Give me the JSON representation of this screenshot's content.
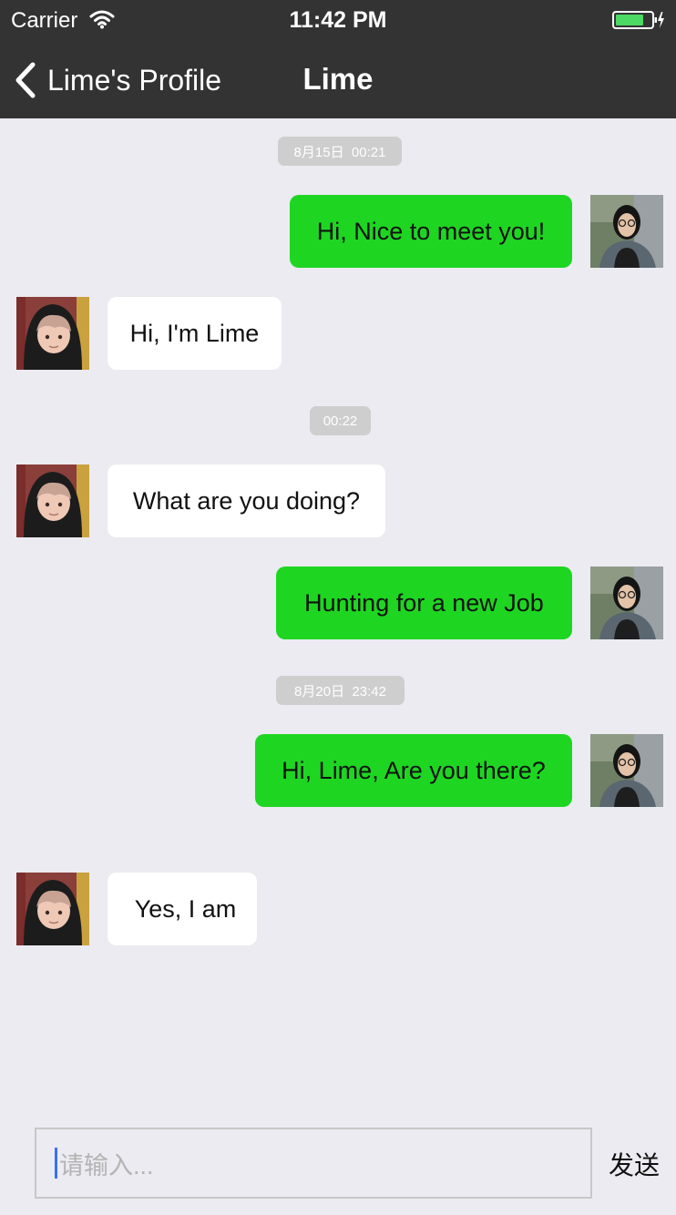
{
  "status_bar": {
    "carrier": "Carrier",
    "time": "11:42 PM",
    "icons": [
      "wifi-icon",
      "battery-icon"
    ]
  },
  "nav": {
    "back_label": "Lime's Profile",
    "title": "Lime"
  },
  "chat": {
    "timestamps": [
      "8月15日  00:21",
      "00:22",
      "8月20日  23:42"
    ],
    "messages": [
      {
        "from": "me",
        "text": "Hi, Nice to meet you!"
      },
      {
        "from": "lime",
        "text": "Hi, I'm Lime"
      },
      {
        "from": "lime",
        "text": "What are you doing?"
      },
      {
        "from": "me",
        "text": "Hunting for a new Job"
      },
      {
        "from": "me",
        "text": "Hi, Lime, Are you there?"
      },
      {
        "from": "lime",
        "text": " Yes, I am"
      }
    ]
  },
  "input": {
    "placeholder": "请输入...",
    "send_label": "发送"
  },
  "colors": {
    "nav_background": "#333333",
    "chat_background": "#ebebf1",
    "outgoing_bubble": "#1ed622",
    "incoming_bubble": "#ffffff",
    "timestamp_pill": "#cecece",
    "caret": "#3b6ff5"
  }
}
